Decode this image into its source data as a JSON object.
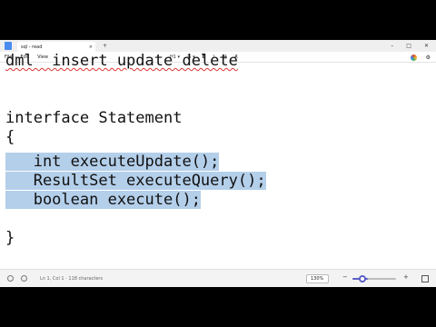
{
  "window": {
    "tab_title": "sql - read",
    "tab_close": "×",
    "new_tab": "+",
    "minimize": "–",
    "maximize": "□",
    "close": "✕"
  },
  "menu": {
    "file": "File",
    "edit": "Edit",
    "view": "View"
  },
  "format_toolbar": {
    "heading": "H1 ▾",
    "list": "☰ ▾",
    "bold": "B",
    "italic": "I",
    "link": "⛓",
    "clear": "A̸"
  },
  "editor": {
    "lines": [
      "dml  insert update delete",
      "",
      "",
      "interface Statement",
      "{",
      "   int executeUpdate();",
      "   ResultSet executeQuery();",
      "   boolean execute();",
      "",
      "}"
    ]
  },
  "status": {
    "position": "Ln 1, Col 1 · 118 characters",
    "zoom": "130%",
    "zoom_out": "−",
    "zoom_in": "+",
    "selection_color": "#b4cfea",
    "zoom_level_fraction": 0.35
  }
}
